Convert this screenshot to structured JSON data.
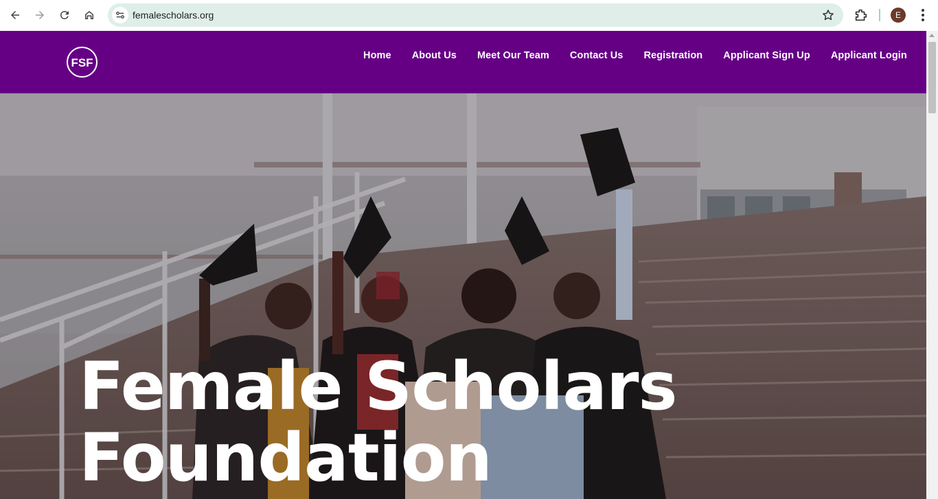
{
  "browser": {
    "url": "femalescholars.org",
    "profile_initial": "E",
    "icons": [
      "back-icon",
      "forward-icon",
      "reload-icon",
      "home-icon",
      "site-info-icon",
      "bookmark-star-icon",
      "extensions-icon",
      "more-menu-icon"
    ]
  },
  "site": {
    "logo_text": "FSF",
    "nav": [
      "Home",
      "About Us",
      "Meet Our Team",
      "Contact Us",
      "Registration",
      "Applicant Sign Up",
      "Applicant Login"
    ],
    "hero_title_line1": "Female Scholars",
    "hero_title_line2": "Foundation"
  },
  "colors": {
    "header_bg": "#650085",
    "omnibox_bg": "#dfeee9",
    "nav_text": "#ffffff"
  }
}
